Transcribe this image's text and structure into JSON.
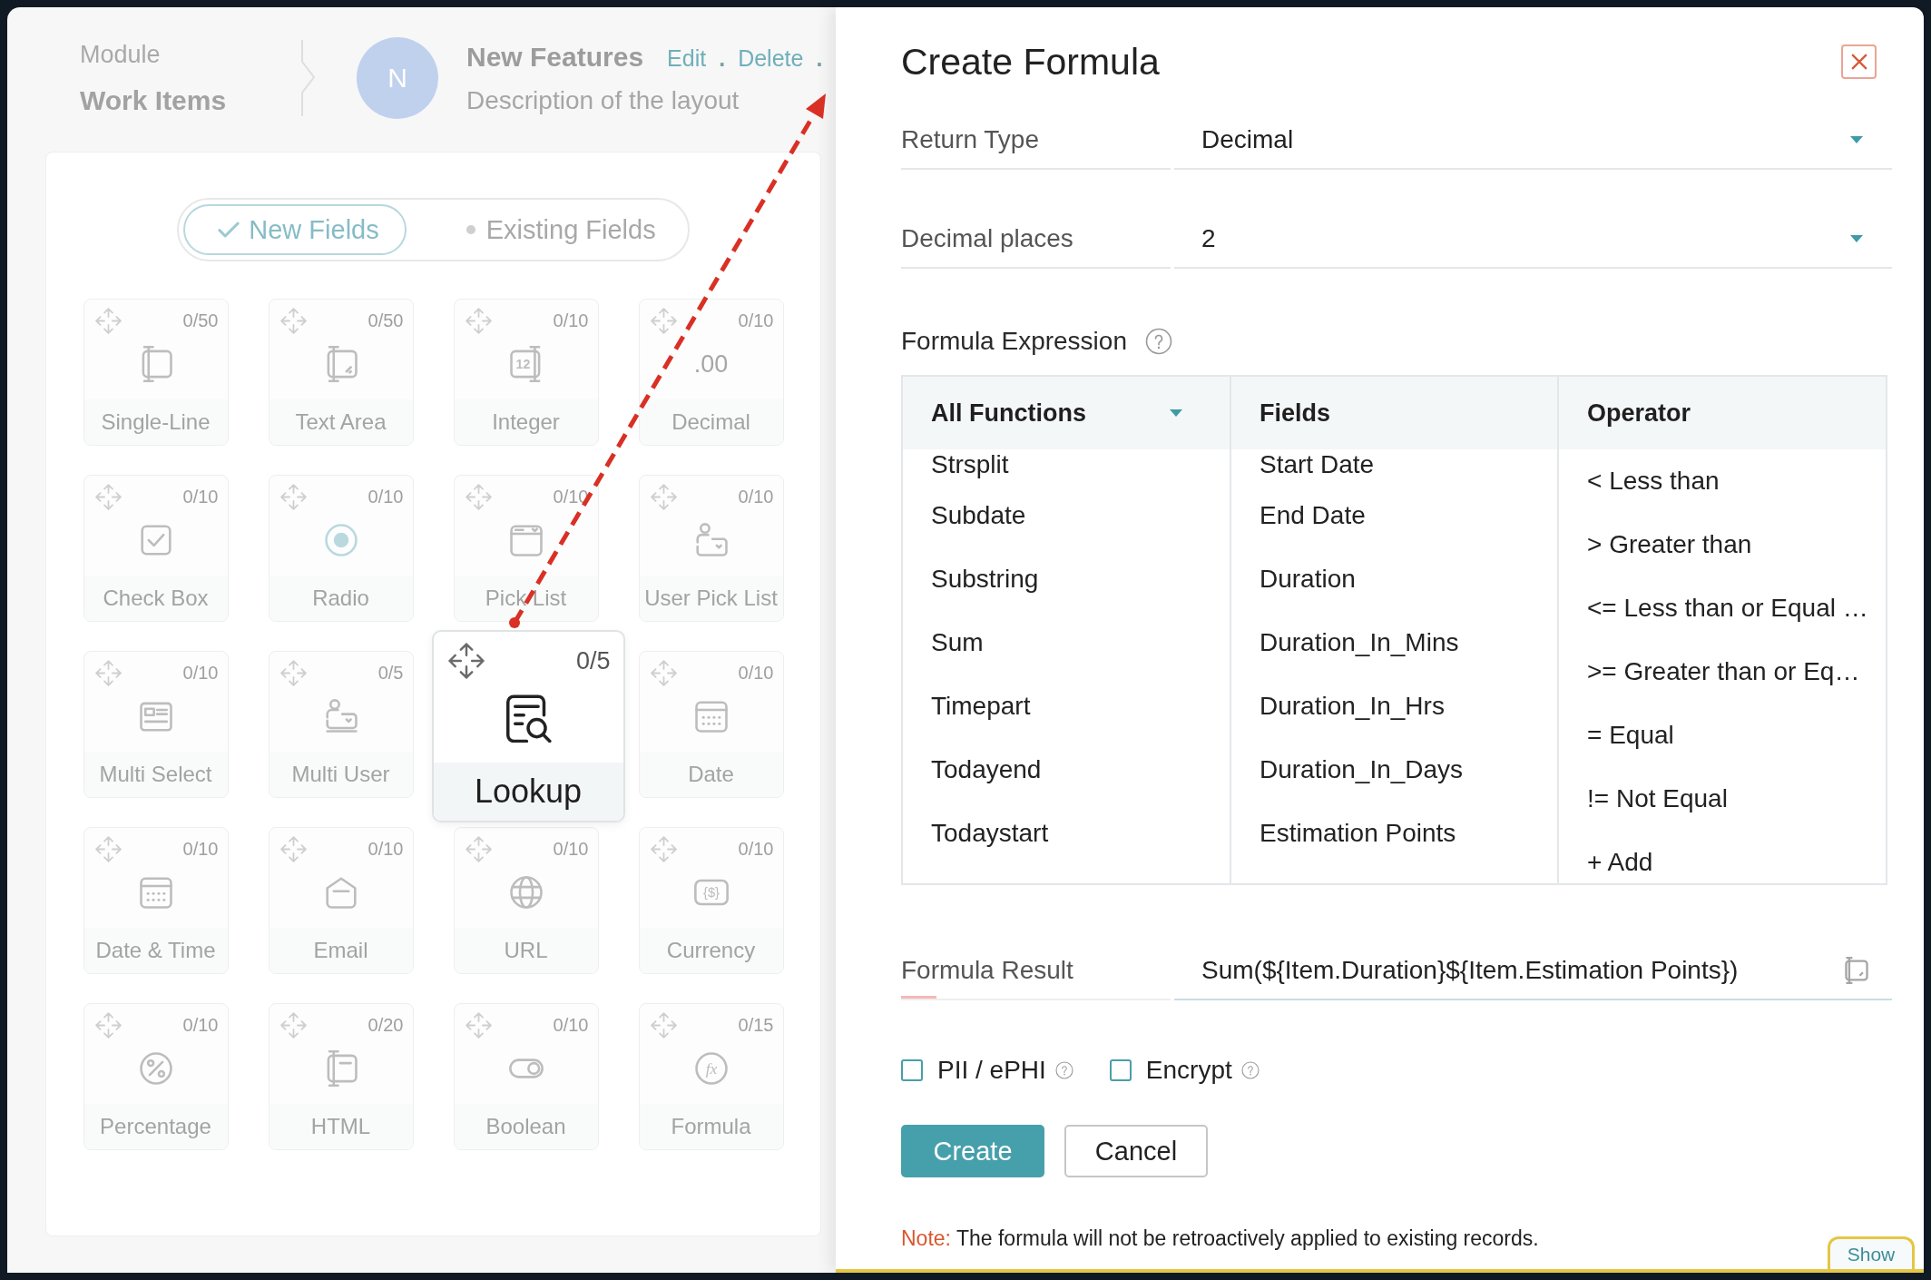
{
  "left_panel": {
    "breadcrumb": {
      "label": "Module",
      "current": "Work Items"
    },
    "layout": {
      "avatar": "N",
      "title": "New Features",
      "actions": [
        {
          "kind": "link",
          "text": "Edit"
        },
        {
          "kind": "separator",
          "text": "."
        },
        {
          "kind": "link",
          "text": "Delete"
        },
        {
          "kind": "separator",
          "text": "."
        }
      ],
      "description": "Description of the layout"
    },
    "field_tabs": [
      {
        "label": "New Fields",
        "selected": true
      },
      {
        "label": "Existing Fields",
        "selected": false
      }
    ],
    "field_types": [
      {
        "kind": "singleline",
        "label": "Single-Line",
        "count": "0/50",
        "highlighted": false
      },
      {
        "kind": "textarea",
        "label": "Text Area",
        "count": "0/50",
        "highlighted": false
      },
      {
        "kind": "integer",
        "label": "Integer",
        "count": "0/10",
        "icon_text": "12",
        "highlighted": false
      },
      {
        "kind": "decimal",
        "label": "Decimal",
        "count": "0/10",
        "icon_text": ".00",
        "highlighted": false
      },
      {
        "kind": "checkbox",
        "label": "Check Box",
        "count": "0/10",
        "highlighted": false
      },
      {
        "kind": "radio",
        "label": "Radio",
        "count": "0/10",
        "highlighted": false
      },
      {
        "kind": "picklist",
        "label": "Pick List",
        "count": "0/10",
        "highlighted": false
      },
      {
        "kind": "userpicklist",
        "label": "User Pick List",
        "count": "0/10",
        "highlighted": false
      },
      {
        "kind": "multiselect",
        "label": "Multi Select",
        "count": "0/10",
        "highlighted": false
      },
      {
        "kind": "multiuser",
        "label": "Multi User",
        "count": "0/5",
        "highlighted": false
      },
      {
        "kind": "lookup",
        "label": "Lookup",
        "count": "0/5",
        "highlighted": true
      },
      {
        "kind": "date",
        "label": "Date",
        "count": "0/10",
        "highlighted": false
      },
      {
        "kind": "datetime",
        "label": "Date & Time",
        "count": "0/10",
        "highlighted": false
      },
      {
        "kind": "email",
        "label": "Email",
        "count": "0/10",
        "highlighted": false
      },
      {
        "kind": "url",
        "label": "URL",
        "count": "0/10",
        "highlighted": false
      },
      {
        "kind": "currency",
        "label": "Currency",
        "count": "0/10",
        "icon_text": "{$}",
        "highlighted": false
      },
      {
        "kind": "percentage",
        "label": "Percentage",
        "count": "0/10",
        "highlighted": false
      },
      {
        "kind": "html",
        "label": "HTML",
        "count": "0/20",
        "highlighted": false
      },
      {
        "kind": "boolean",
        "label": "Boolean",
        "count": "0/10",
        "highlighted": false
      },
      {
        "kind": "formula",
        "label": "Formula",
        "count": "0/15",
        "icon_text": "fx",
        "highlighted": false
      }
    ]
  },
  "formula_dialog": {
    "title": "Create Formula",
    "fields": [
      {
        "kind": "dropdown",
        "label": "Return Type",
        "value": "Decimal"
      },
      {
        "kind": "dropdown",
        "label": "Decimal places",
        "value": "2"
      }
    ],
    "expression": {
      "label": "Formula Expression",
      "columns": [
        {
          "heading": "All Functions",
          "dropdown": true,
          "scrolled": true,
          "items": [
            "Strsplit",
            "Subdate",
            "Substring",
            "Sum",
            "Timepart",
            "Todayend",
            "Todaystart"
          ]
        },
        {
          "heading": "Fields",
          "dropdown": false,
          "scrolled": true,
          "items": [
            "Start Date",
            "End Date",
            "Duration",
            "Duration_In_Mins",
            "Duration_In_Hrs",
            "Duration_In_Days",
            "Estimation Points"
          ]
        },
        {
          "heading": "Operator",
          "dropdown": false,
          "scrolled": false,
          "items": [
            "< Less than",
            "> Greater than",
            "<= Less than or Equal …",
            ">= Greater than or Eq…",
            "= Equal",
            "!= Not Equal",
            "+ Add"
          ]
        }
      ]
    },
    "result": {
      "label": "Formula Result",
      "value": "Sum(${Item.Duration}${Item.Estimation Points})"
    },
    "options": [
      {
        "label": "PII / ePHI",
        "checked": false
      },
      {
        "label": "Encrypt",
        "checked": false
      }
    ],
    "buttons": [
      {
        "kind": "submit",
        "label": "Create"
      },
      {
        "kind": "cancel",
        "label": "Cancel"
      }
    ],
    "note": {
      "label": "Note:",
      "text": "The formula will not be retroactively applied to existing records."
    }
  },
  "show_tab": {
    "label": "Show"
  }
}
